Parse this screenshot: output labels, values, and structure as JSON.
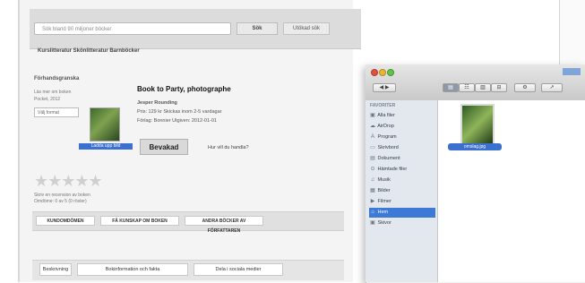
{
  "browser": {
    "search_placeholder": "Sök bland 90 miljoner böcker",
    "search_button": "Sök",
    "advanced_button": "Utökad sök",
    "breadcrumb": "Kurslitteratur    Skönlitteratur    Barnböcker"
  },
  "product": {
    "section_label": "Förhandsgranska",
    "meta": [
      "Läs mer om boken",
      "Pocket, 2012"
    ],
    "select_value": "Välj format",
    "title": "Book to Party, photographe",
    "subtitle": "Jesper Rounding",
    "details": [
      "Pris: 129 kr   Skickas inom 2-5 vardagar",
      "Förlag: Bonnier   Utgiven: 2012-01-01"
    ],
    "thumb_caption": "Ladda upp bild",
    "buy_label": "Bevakad",
    "aside_link": "Hur vill du handla?",
    "stars": "★★★★★",
    "rating_note": "Skriv en recension av boken",
    "rating_note2": "Omdöme: 0 av 5 (0 röster)"
  },
  "tabs": {
    "items": [
      "KUNDOMDÖMEN",
      "FÅ KUNSKAP OM BOKEN",
      "ANDRA BÖCKER AV FÖRFATTAREN"
    ]
  },
  "bottom_tabs": {
    "items": [
      "Beskrivning",
      "Bokinformation och fakta",
      "Dela i sociala medier"
    ]
  },
  "finder": {
    "toolbar_buttons": [
      "◀ ▶",
      "▤",
      "☷",
      "▥",
      "⊟",
      "⚙",
      "↗"
    ],
    "sidebar_header": "FAVORITER",
    "sidebar_items": [
      {
        "icon": "▣",
        "label": "Alla filer"
      },
      {
        "icon": "☁",
        "label": "AirDrop"
      },
      {
        "icon": "A",
        "label": "Program"
      },
      {
        "icon": "▭",
        "label": "Skrivbord"
      },
      {
        "icon": "▤",
        "label": "Dokument"
      },
      {
        "icon": "⊙",
        "label": "Hämtade filer"
      },
      {
        "icon": "♫",
        "label": "Musik"
      },
      {
        "icon": "▦",
        "label": "Bilder"
      },
      {
        "icon": "▶",
        "label": "Filmer"
      },
      {
        "icon": "⌂",
        "label": "Hem"
      },
      {
        "icon": "▣",
        "label": "Skivor"
      }
    ],
    "selected_index": 9,
    "file_label": "omslag.jpg"
  },
  "colors": {
    "selection": "#3d79d6",
    "finder_sidebar": "#e3e8ef"
  }
}
